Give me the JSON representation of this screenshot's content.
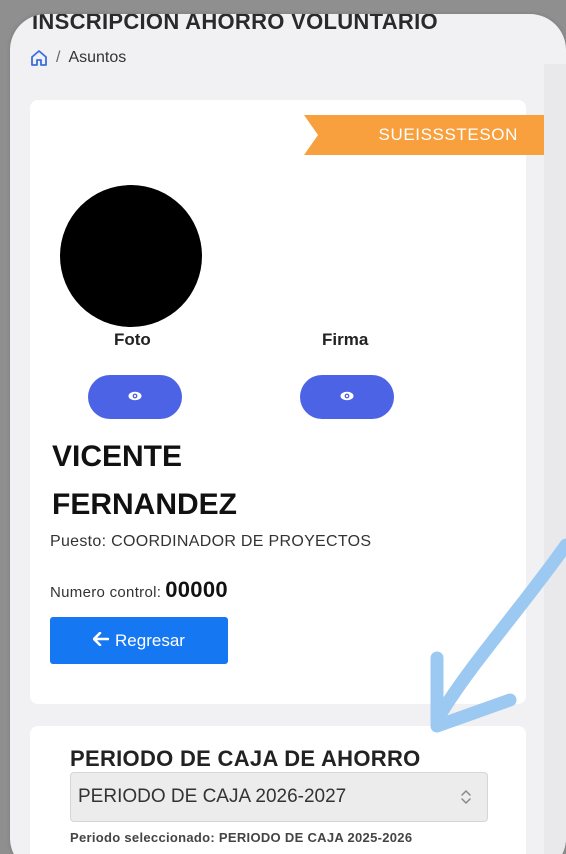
{
  "header": {
    "title": "INSCRIPCION AHORRO VOLUNTARIO",
    "breadcrumb": {
      "separator": "/",
      "current": "Asuntos"
    }
  },
  "profile": {
    "union_badge": "SUEISSSTESON",
    "photo_label": "Foto",
    "signature_label": "Firma",
    "name_line1": "VICENTE",
    "name_line2": "FERNANDEZ",
    "position": "Puesto: COORDINADOR DE PROYECTOS",
    "control_label": "Numero control:",
    "control_number": "00000",
    "back_button": "Regresar"
  },
  "periodo": {
    "title": "PERIODO DE CAJA DE AHORRO",
    "selected_option": "PERIODO DE CAJA 2026-2027",
    "selected_note": "Periodo seleccionado: PERIODO DE CAJA 2025-2026"
  },
  "colors": {
    "ribbon": "#f7a03d",
    "eye_button": "#4c63e6",
    "primary_button": "#1677f2",
    "annotation_arrow": "#9cc9f2"
  },
  "icons": [
    "home-icon",
    "eye-icon",
    "arrow-left-icon",
    "chevron-updown-icon"
  ]
}
